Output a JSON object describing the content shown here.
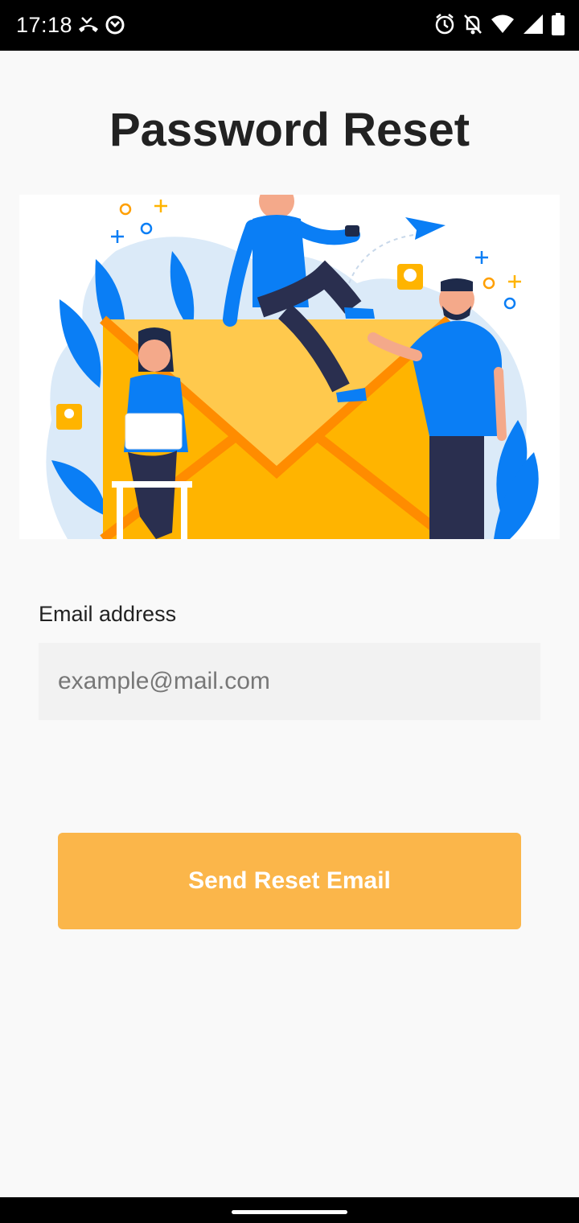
{
  "status_bar": {
    "time": "17:18",
    "left_icons": [
      "missed-call-icon",
      "data-saver-icon"
    ],
    "right_icons": [
      "alarm-icon",
      "notifications-off-icon",
      "wifi-icon",
      "signal-icon",
      "battery-icon"
    ]
  },
  "page": {
    "title": "Password Reset"
  },
  "hero": {
    "illustration": "email-envelope-with-people-illustration"
  },
  "form": {
    "email_label": "Email address",
    "email_placeholder": "example@mail.com",
    "email_value": ""
  },
  "actions": {
    "send_label": "Send Reset Email"
  },
  "colors": {
    "accent": "#fbb64a",
    "envelope": "#ffc94d",
    "brand_blue": "#0a7ef5",
    "background": "#f9f9f9",
    "input_bg": "#f2f2f2"
  }
}
